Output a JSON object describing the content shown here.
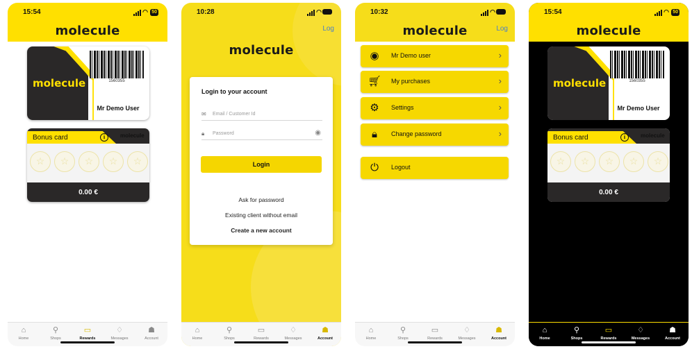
{
  "brand": {
    "name": "molecule"
  },
  "colors": {
    "accent": "#ffe000",
    "dark": "#2a2828",
    "link": "#4a80c8"
  },
  "screens": {
    "rewards": {
      "time": "15:54",
      "battery": "50"
    },
    "login": {
      "time": "10:28",
      "battery": ""
    },
    "account": {
      "time": "10:32",
      "battery": ""
    },
    "rewards_dark": {
      "time": "15:54",
      "battery": "50"
    }
  },
  "header": {
    "log_link": "Log"
  },
  "card": {
    "barcode_number": "1560355",
    "holder": "Mr Demo User",
    "brand": "molecule"
  },
  "bonus": {
    "title": "Bonus card",
    "info": "i",
    "brand": "molecule",
    "amount": "0.00 €",
    "stars": 5
  },
  "login": {
    "title": "Login to your account",
    "email_placeholder": "Email / Customer Id",
    "password_placeholder": "Password",
    "button": "Login",
    "ask_password": "Ask for password",
    "existing_client": "Existing client without email",
    "create_account": "Create a new account"
  },
  "menu": [
    {
      "label": "Mr Demo user",
      "icon": "user-icon"
    },
    {
      "label": "My purchases",
      "icon": "cart-icon"
    },
    {
      "label": "Settings",
      "icon": "gear-icon"
    },
    {
      "label": "Change password",
      "icon": "lock-icon"
    },
    {
      "label": "Logout",
      "icon": "power-icon"
    }
  ],
  "tabs": [
    {
      "label": "Home",
      "icon": "home-icon"
    },
    {
      "label": "Shops",
      "icon": "pin-icon"
    },
    {
      "label": "Rewards",
      "icon": "card-icon"
    },
    {
      "label": "Messages",
      "icon": "bell-icon"
    },
    {
      "label": "Account",
      "icon": "account-icon"
    }
  ]
}
